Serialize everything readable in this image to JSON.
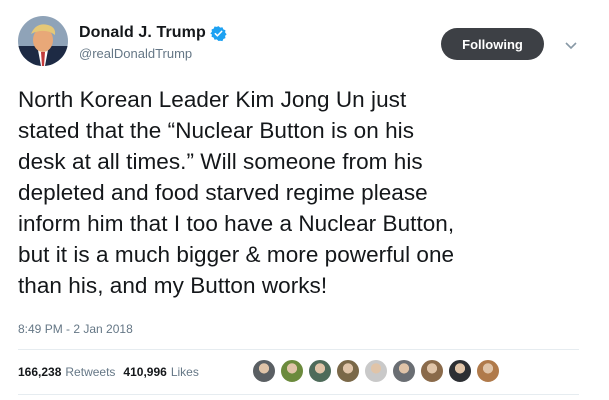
{
  "author": {
    "display_name": "Donald J. Trump",
    "handle": "@realDonaldTrump",
    "verified_icon": "verified-badge-icon",
    "avatar": "profile-photo"
  },
  "follow_button": {
    "label": "Following"
  },
  "menu_icon": "chevron-down-icon",
  "tweet": {
    "text": "North Korean Leader Kim Jong Un just\nstated that the “Nuclear Button is on his\ndesk at all times.” Will someone from his\ndepleted and food starved regime please\ninform him that I too have a Nuclear Button,\nbut it is a much bigger & more powerful one\nthan his, and my Button works!",
    "timestamp": "8:49 PM - 2 Jan 2018"
  },
  "stats": {
    "retweets_count": "166,238",
    "retweets_label": "Retweets",
    "likes_count": "410,996",
    "likes_label": "Likes"
  },
  "likers": [
    {
      "name": "liker-avatar-1",
      "color": "#5a5f63"
    },
    {
      "name": "liker-avatar-2",
      "color": "#6b8a3c"
    },
    {
      "name": "liker-avatar-3",
      "color": "#4e6b5a"
    },
    {
      "name": "liker-avatar-4",
      "color": "#7a6848"
    },
    {
      "name": "liker-avatar-5",
      "color": "#c9c9c9"
    },
    {
      "name": "liker-avatar-6",
      "color": "#6a6e73"
    },
    {
      "name": "liker-avatar-7",
      "color": "#8a6a4a"
    },
    {
      "name": "liker-avatar-8",
      "color": "#2c2f33"
    },
    {
      "name": "liker-avatar-9",
      "color": "#b07a4a"
    }
  ],
  "colors": {
    "text_primary": "#14171a",
    "text_secondary": "#657786",
    "verified_blue": "#1da1f2",
    "button_dark": "#3d4045",
    "divider": "#e6ecf0"
  }
}
